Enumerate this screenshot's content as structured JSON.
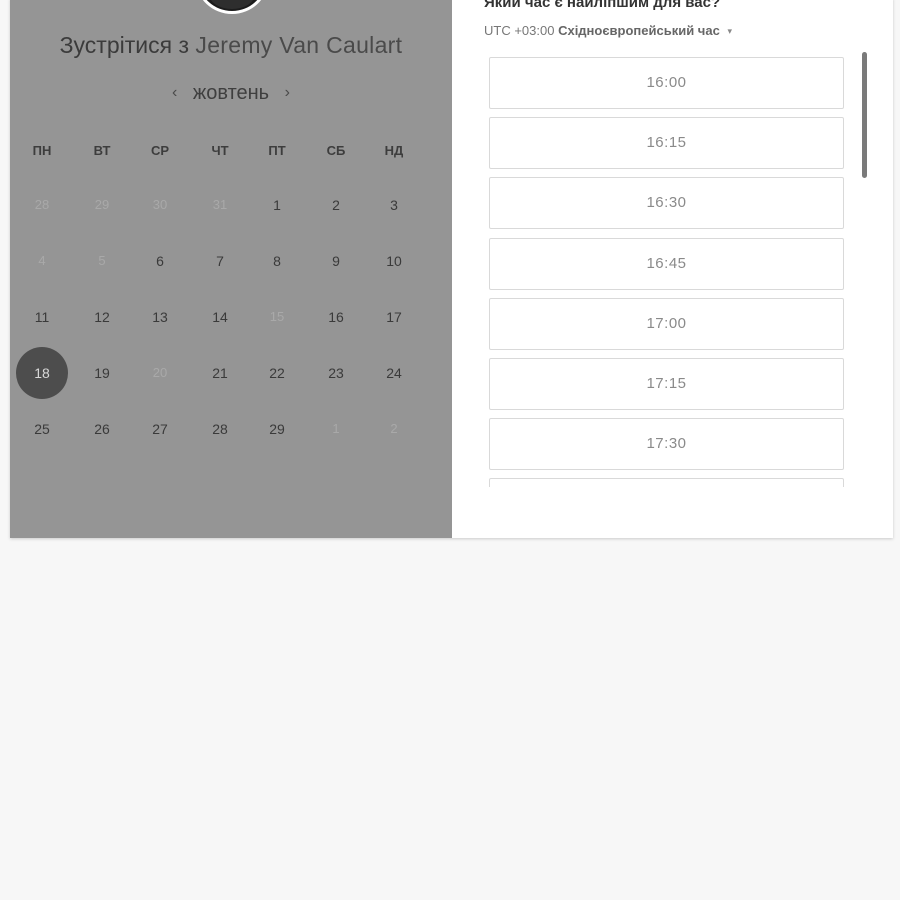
{
  "calendar": {
    "title_prefix": "Зустрітися з",
    "person_name": "Jeremy Van Caulart",
    "month": "жовтень",
    "prev_icon": "‹",
    "next_icon": "›",
    "weekdays": [
      "ПН",
      "ВТ",
      "СР",
      "ЧТ",
      "ПТ",
      "СБ",
      "НД"
    ],
    "days": [
      [
        "28",
        "29",
        "30",
        "31",
        "1",
        "2",
        "3"
      ],
      [
        "4",
        "5",
        "6",
        "7",
        "8",
        "9",
        "10"
      ],
      [
        "11",
        "12",
        "13",
        "14",
        "15",
        "16",
        "17"
      ],
      [
        "18",
        "19",
        "20",
        "21",
        "22",
        "23",
        "24"
      ],
      [
        "25",
        "26",
        "27",
        "28",
        "29",
        "1",
        "2"
      ]
    ],
    "unavailable": [
      [
        true,
        true,
        true,
        true,
        false,
        false,
        false
      ],
      [
        true,
        true,
        false,
        false,
        false,
        false,
        false
      ],
      [
        false,
        false,
        false,
        false,
        true,
        false,
        false
      ],
      [
        false,
        false,
        true,
        false,
        false,
        false,
        false
      ],
      [
        false,
        false,
        false,
        false,
        false,
        true,
        true
      ]
    ],
    "selected_day": "18"
  },
  "booking": {
    "question": "Який час є найліпшим для вас?",
    "timezone_offset": "UTC +03:00",
    "timezone_name": "Східноєвропейський час",
    "timezone_caret": "▾",
    "slots": [
      "16:00",
      "16:15",
      "16:30",
      "16:45",
      "17:00",
      "17:15",
      "17:30",
      ""
    ]
  }
}
